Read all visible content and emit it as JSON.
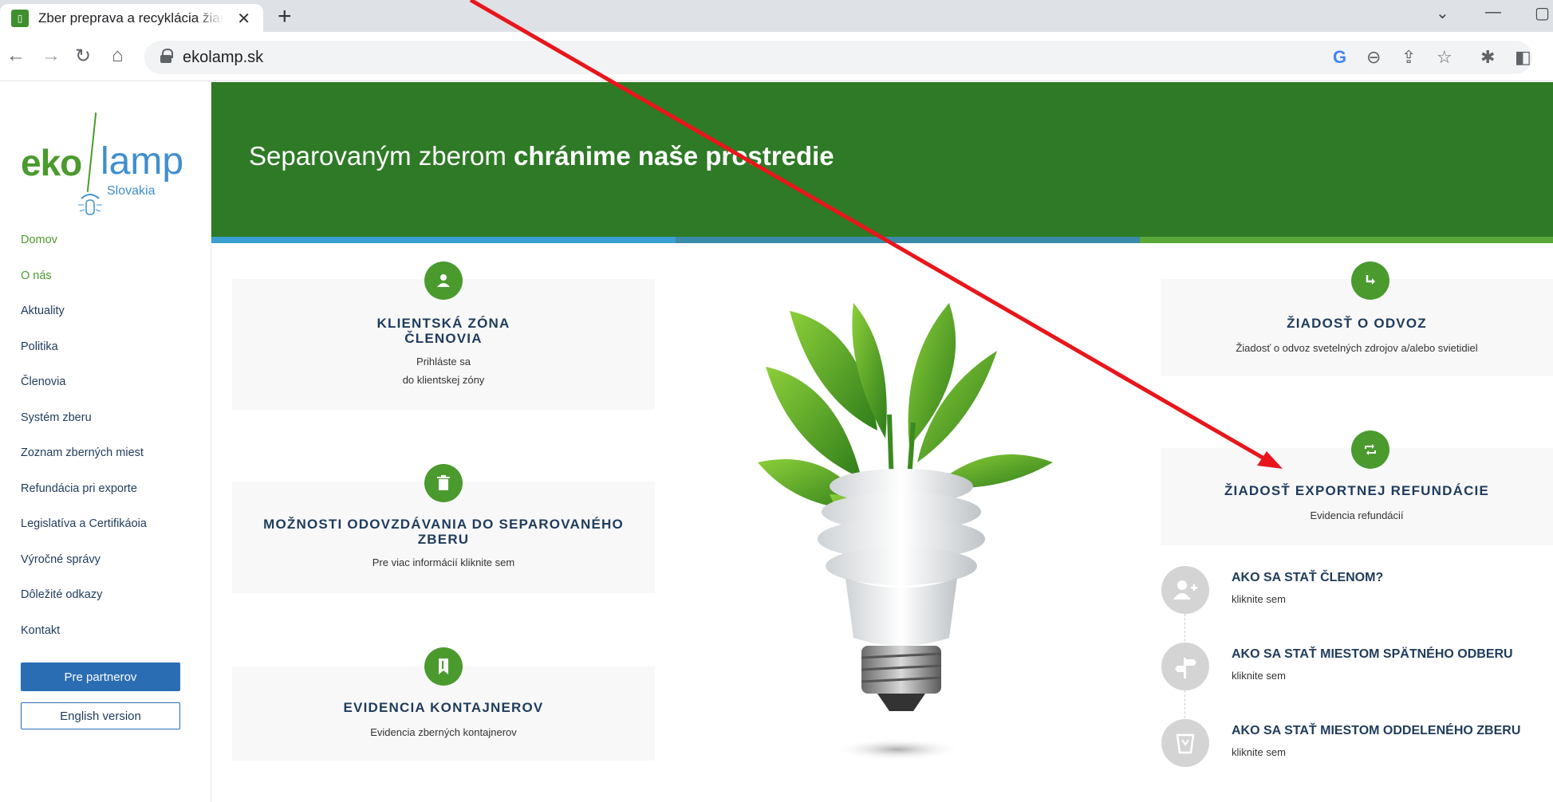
{
  "browser": {
    "tab_title": "Zber preprava a recyklácia žiariv",
    "url": "ekolamp.sk"
  },
  "sidebar": {
    "logo": {
      "brand_left": "eko",
      "brand_right": "lamp",
      "brand_sub": "Slovakia"
    },
    "menu": [
      {
        "label": "Domov",
        "active": true
      },
      {
        "label": "O nás",
        "active": true
      },
      {
        "label": "Aktuality"
      },
      {
        "label": "Politika"
      },
      {
        "label": "Členovia"
      },
      {
        "label": "Systém zberu"
      },
      {
        "label": "Zoznam zberných miest"
      },
      {
        "label": "Refundácia pri exporte"
      },
      {
        "label": "Legislatíva a Certifikáoia"
      },
      {
        "label": "Výročné správy"
      },
      {
        "label": "Dôležité odkazy"
      },
      {
        "label": "Kontakt"
      }
    ],
    "partner_button": "Pre partnerov",
    "english_button": "English version"
  },
  "hero": {
    "text_normal": "Separovaným zberom ",
    "text_bold": "chránime naše prostredie",
    "stripe_colors": [
      "#3aa0d2",
      "#3a8ba8",
      "#5aa83a"
    ]
  },
  "cards": {
    "client_zone": {
      "title_line1": "KLIENTSKÁ ZÓNA",
      "title_line2": "ČLENOVIA",
      "text_line1": "Prihláste sa",
      "text_line2": "do klientskej zóny",
      "icon": "user-icon"
    },
    "separation": {
      "title_line1": "MOŽNOSTI ODOVZDÁVANIA DO SEPAROVANÉHO",
      "title_line2": "ZBERU",
      "text": "Pre viac informácií kliknite sem",
      "icon": "trash-icon"
    },
    "containers": {
      "title": "EVIDENCIA KONTAJNEROV",
      "text": "Evidencia zberných kontajnerov",
      "icon": "bookmark-icon"
    },
    "pickup": {
      "title": "ŽIADOSŤ O ODVOZ",
      "text": "Žiadosť o odvoz svetelných zdrojov a/alebo svietidiel",
      "icon": "arrow-turn-icon"
    },
    "refund": {
      "title": "ŽIADOSŤ EXPORTNEJ REFUNDÁCIE",
      "text": "Evidencia refundácií",
      "icon": "refresh-icon"
    }
  },
  "steps": [
    {
      "title": "AKO SA STAŤ ČLENOM?",
      "link": "kliknite sem",
      "icon": "add-user-icon"
    },
    {
      "title": "AKO SA STAŤ MIESTOM SPÄTNÉHO ODBERU",
      "link": "kliknite sem",
      "icon": "signpost-icon"
    },
    {
      "title": "AKO SA STAŤ MIESTOM ODDELENÉHO ZBERU",
      "link": "kliknite sem",
      "icon": "bin-icon"
    }
  ],
  "colors": {
    "brand_green": "#2e7a26",
    "accent_green": "#4a9a2e",
    "navy": "#1f3b5c",
    "blue": "#2a6db3",
    "annotation_red": "#e8161b"
  }
}
